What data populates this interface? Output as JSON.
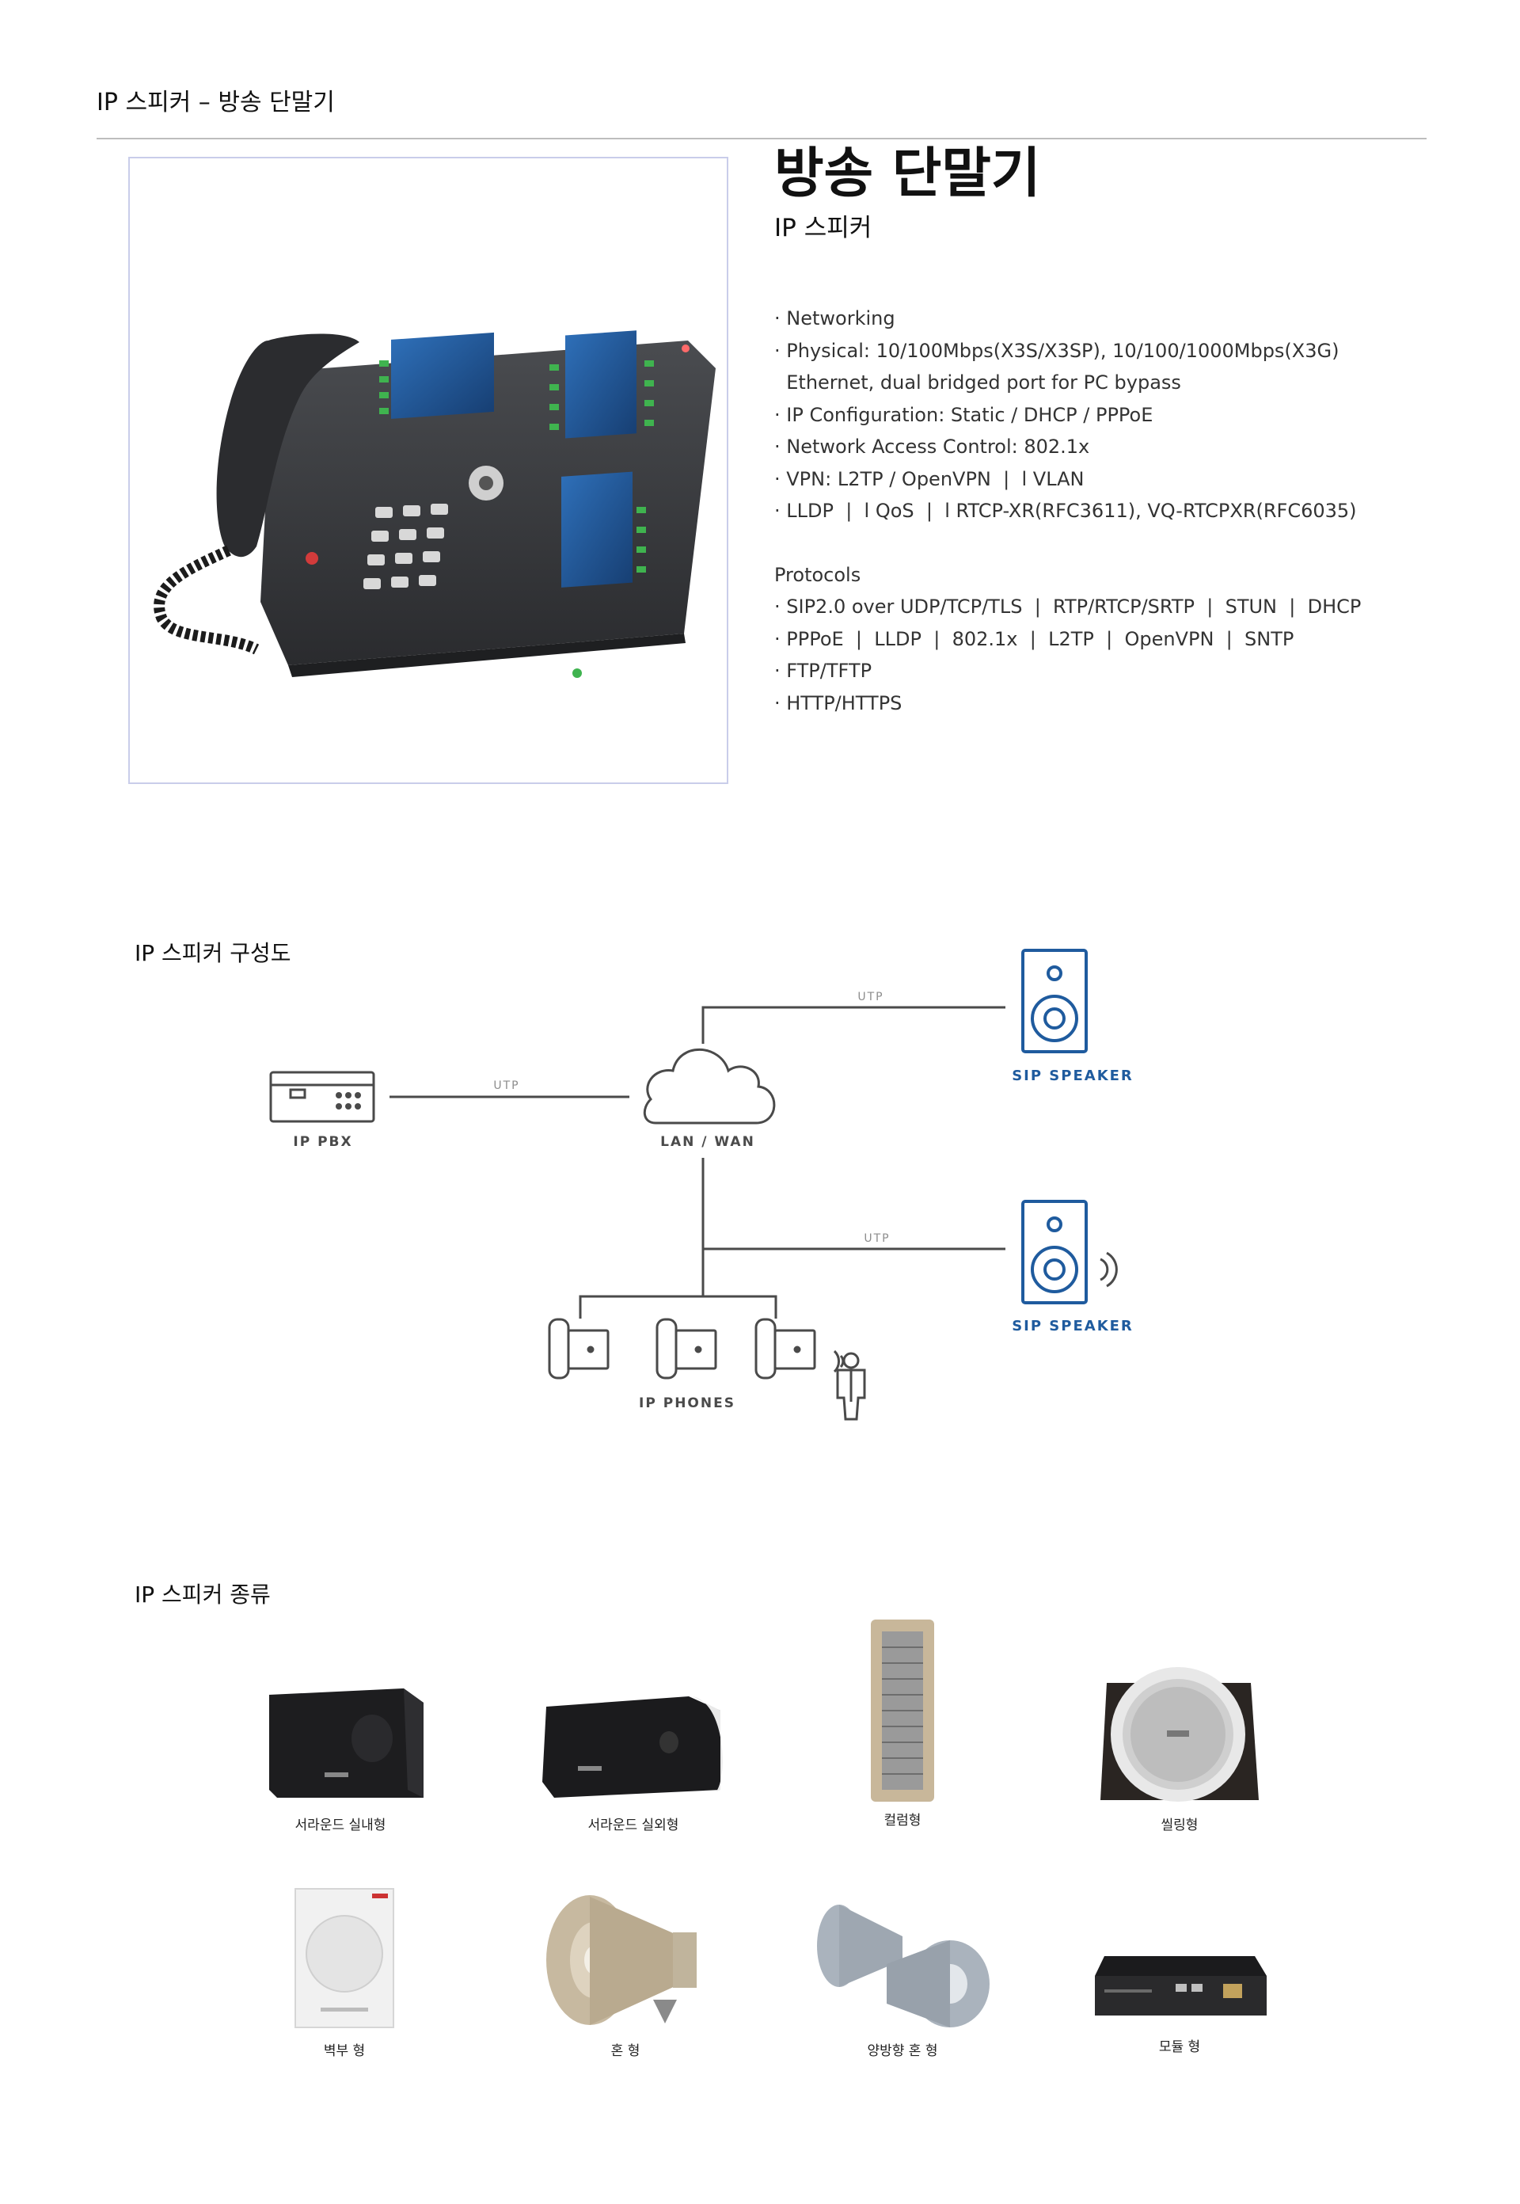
{
  "header": {
    "title": "IP 스피커 – 방송 단말기"
  },
  "product": {
    "title": "방송 단말기",
    "subtitle": "IP 스피커",
    "image_alt": "IP phone with expansion modules"
  },
  "specs": {
    "networking": [
      "· Networking",
      "· Physical: 10/100Mbps(X3S/X3SP), 10/100/1000Mbps(X3G)",
      "  Ethernet, dual bridged port for PC bypass",
      "· IP Configuration: Static / DHCP / PPPoE",
      "· Network Access Control: 802.1x",
      "· VPN: L2TP / OpenVPN  |  l VLAN",
      "· LLDP  |  l QoS  |  l RTCP-XR(RFC3611), VQ-RTCPXR(RFC6035)"
    ],
    "protocols_title": "Protocols",
    "protocols": [
      "· SIP2.0 over UDP/TCP/TLS  |  RTP/RTCP/SRTP  |  STUN  |  DHCP",
      "· PPPoE  |  LLDP  |  802.1x  |  L2TP  |  OpenVPN  |  SNTP",
      "· FTP/TFTP",
      "· HTTP/HTTPS"
    ]
  },
  "diagram": {
    "section_title": "IP 스피커 구성도",
    "ip_pbx": "IP PBX",
    "lan_wan": "LAN / WAN",
    "sip_speaker_1": "SIP SPEAKER",
    "sip_speaker_2": "SIP SPEAKER",
    "ip_phones": "IP PHONES",
    "utp_1": "UTP",
    "utp_2": "UTP",
    "utp_3": "UTP",
    "colors": {
      "line": "#4a4a4a",
      "speaker": "#1f5b9e"
    }
  },
  "speaker_types": {
    "section_title": "IP 스피커 종류",
    "items": [
      {
        "label": "서라운드 실내형",
        "icon": "indoor-speaker-image"
      },
      {
        "label": "서라운드 실외형",
        "icon": "outdoor-speaker-image"
      },
      {
        "label": "컬럼형",
        "icon": "column-speaker-image"
      },
      {
        "label": "씰링형",
        "icon": "ceiling-speaker-image"
      },
      {
        "label": "벽부 형",
        "icon": "wall-speaker-image"
      },
      {
        "label": "혼 형",
        "icon": "horn-speaker-image"
      },
      {
        "label": "양방향 혼 형",
        "icon": "dual-horn-speaker-image"
      },
      {
        "label": "모듈 형",
        "icon": "module-device-image"
      }
    ]
  }
}
